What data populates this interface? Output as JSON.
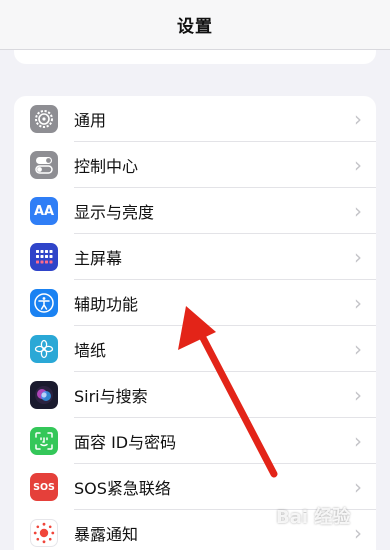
{
  "header": {
    "title": "设置"
  },
  "settings": [
    {
      "label": "通用",
      "icon": "gear-icon",
      "color": "#8e8e93"
    },
    {
      "label": "控制中心",
      "icon": "toggle-switches-icon",
      "color": "#8e8e93"
    },
    {
      "label": "显示与亮度",
      "icon": "text-size-icon",
      "color": "#2f7ef6",
      "glyph": "AA"
    },
    {
      "label": "主屏幕",
      "icon": "home-screen-grid-icon",
      "color": "#2f44c9"
    },
    {
      "label": "辅助功能",
      "icon": "accessibility-icon",
      "color": "#1a82f2"
    },
    {
      "label": "墙纸",
      "icon": "wallpaper-flower-icon",
      "color": "#2aa8d6"
    },
    {
      "label": "Siri与搜索",
      "icon": "siri-icon",
      "color": "#1a1a2e"
    },
    {
      "label": "面容 ID与密码",
      "icon": "face-id-icon",
      "color": "#34c759"
    },
    {
      "label": "SOS紧急联络",
      "icon": "sos-icon",
      "color": "#e5403a",
      "glyph": "SOS"
    },
    {
      "label": "暴露通知",
      "icon": "exposure-notification-icon",
      "color": "#ffffff"
    }
  ],
  "annotation": {
    "color": "#e32418"
  },
  "watermark": "Bai 经验"
}
